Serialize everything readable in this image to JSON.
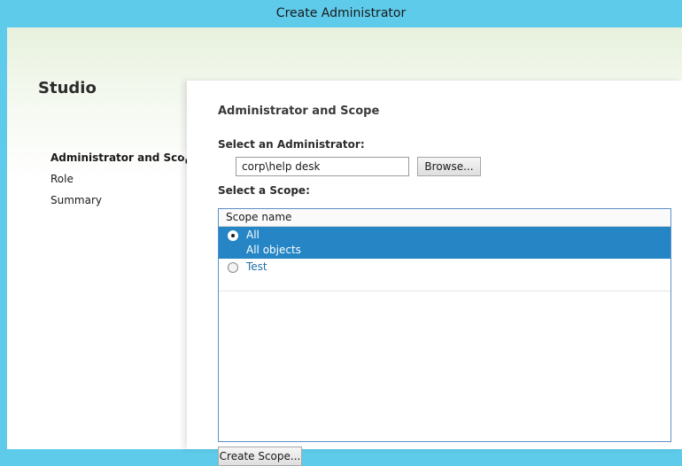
{
  "window": {
    "title": "Create Administrator"
  },
  "sidebar": {
    "title": "Studio",
    "items": [
      {
        "label": "Administrator and Scope",
        "active": true
      },
      {
        "label": "Role",
        "active": false
      },
      {
        "label": "Summary",
        "active": false
      }
    ]
  },
  "main": {
    "heading": "Administrator and Scope",
    "admin_label": "Select an Administrator:",
    "admin_value": "corp\\help desk",
    "browse_label": "Browse...",
    "scope_label": "Select a Scope:",
    "scope_table": {
      "column_header": "Scope name",
      "rows": [
        {
          "name": "All",
          "description": "All objects",
          "selected": true
        },
        {
          "name": "Test",
          "description": "",
          "selected": false
        }
      ]
    },
    "create_scope_label": "Create Scope..."
  },
  "colors": {
    "titlebar": "#5ecbea",
    "selection": "#2585c5",
    "link": "#1f6fa8"
  }
}
